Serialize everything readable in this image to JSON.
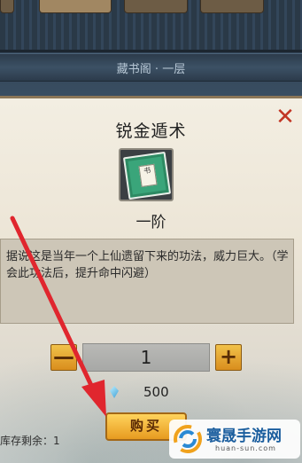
{
  "top_tabs": [
    "",
    "",
    "",
    ""
  ],
  "header": {
    "title": "藏书阁 · 一层"
  },
  "skill": {
    "name": "锐金遁术",
    "book_label": "书",
    "rank": "一阶",
    "description": "据说这是当年一个上仙遗留下来的功法，威力巨大。（学会此功法后，提升命中闪避）"
  },
  "quantity": {
    "value": "1",
    "minus": "—",
    "plus": "+"
  },
  "price": {
    "amount": "500",
    "currency_icon": "diamond-gem-icon"
  },
  "buy_button": {
    "label": "购买"
  },
  "stock": {
    "text": "库存剩余：1"
  },
  "close_icon": "close-x-icon",
  "watermark": {
    "name": "寰晟手游网",
    "url": "huan-sun.com"
  },
  "colors": {
    "accent_gold": "#e79b20",
    "close_red": "#c23524",
    "arrow_red": "#e0262e",
    "gem_blue": "#3d9fd6"
  }
}
